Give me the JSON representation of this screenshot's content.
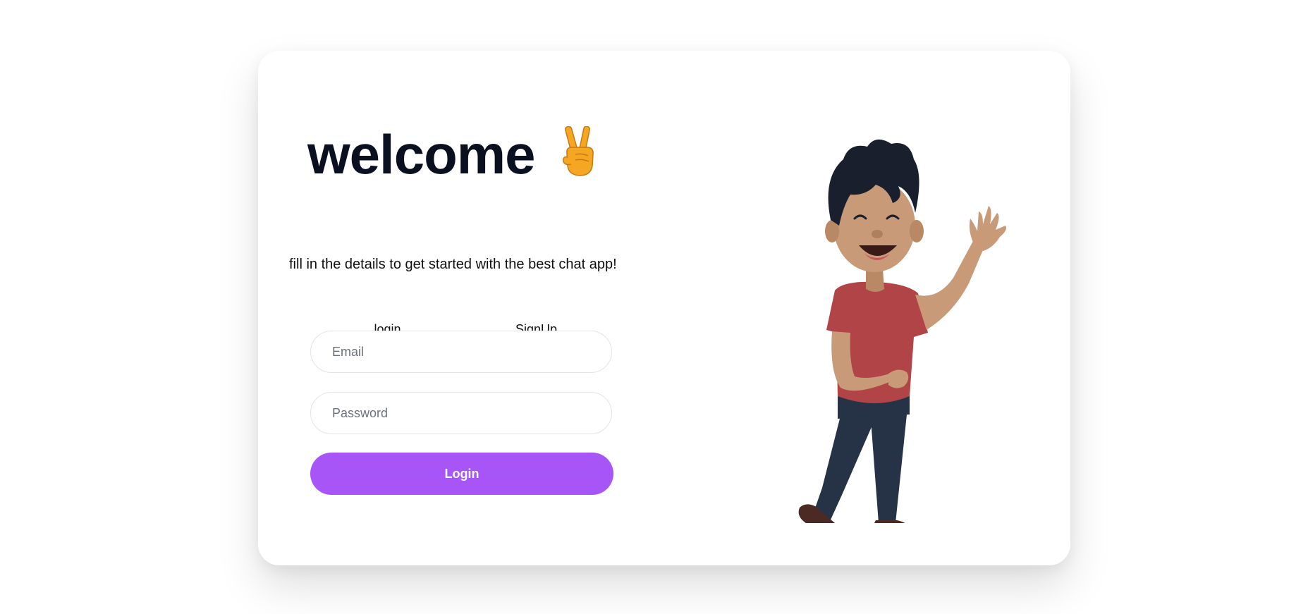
{
  "welcome": {
    "title": "welcome",
    "emoji_icon": "victory-hand-icon",
    "subtitle": "fill in the details to get started with the best chat app!"
  },
  "tabs": [
    {
      "label": "login",
      "active": true
    },
    {
      "label": "SignUp",
      "active": false
    }
  ],
  "form": {
    "email_placeholder": "Email",
    "email_value": "",
    "password_placeholder": "Password",
    "password_value": "",
    "submit_label": "Login"
  },
  "illustration": {
    "icon": "waving-person-illustration"
  },
  "colors": {
    "accent": "#a855f7",
    "title": "#0b1020",
    "shirt": "#b04446",
    "pants": "#263246",
    "skin": "#c89a78",
    "hair": "#1a1f2e"
  }
}
